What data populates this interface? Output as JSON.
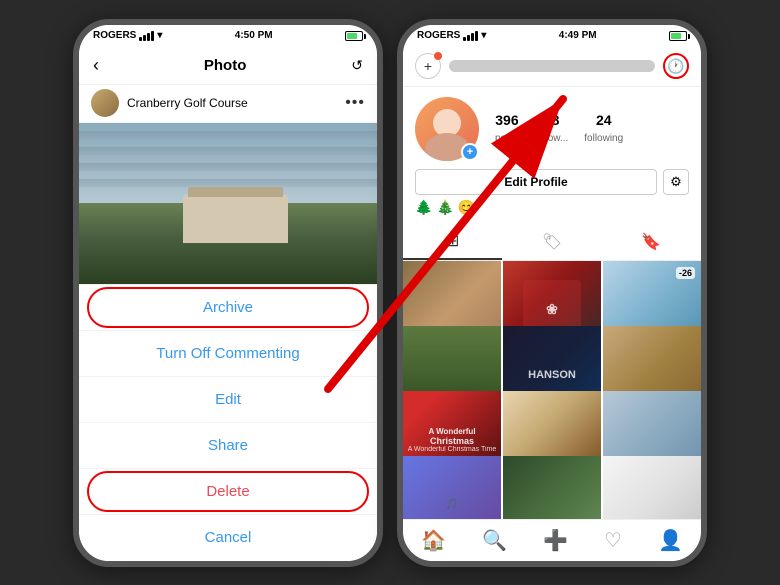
{
  "left_phone": {
    "status": {
      "carrier": "ROGERS",
      "time": "4:50 PM",
      "battery_level": "70"
    },
    "nav": {
      "title": "Photo",
      "back_label": "‹",
      "reload_label": "↺"
    },
    "profile": {
      "name": "Cranberry Golf Course",
      "more": "•••"
    },
    "menu": {
      "archive": "Archive",
      "turn_off_commenting": "Turn Off Commenting",
      "edit": "Edit",
      "share": "Share",
      "delete": "Delete",
      "cancel": "Cancel"
    }
  },
  "right_phone": {
    "status": {
      "carrier": "ROGERS",
      "time": "4:49 PM"
    },
    "stats": {
      "posts": "396",
      "posts_label": "posts",
      "followers": "48",
      "followers_label": "follow...",
      "following": "24",
      "following_label": "following"
    },
    "profile": {
      "edit_button": "Edit Profile",
      "settings_icon": "⚙"
    },
    "emojis": [
      "🌲",
      "🎄",
      "😊"
    ],
    "tabs": {
      "grid": "⊞",
      "tag": "🏷",
      "bookmark": "🔖"
    },
    "bottom_tabs": {
      "home": "🏠",
      "search": "🔍",
      "add": "➕",
      "heart": "♡",
      "profile": "👤"
    },
    "archive_icon": "🕐"
  }
}
